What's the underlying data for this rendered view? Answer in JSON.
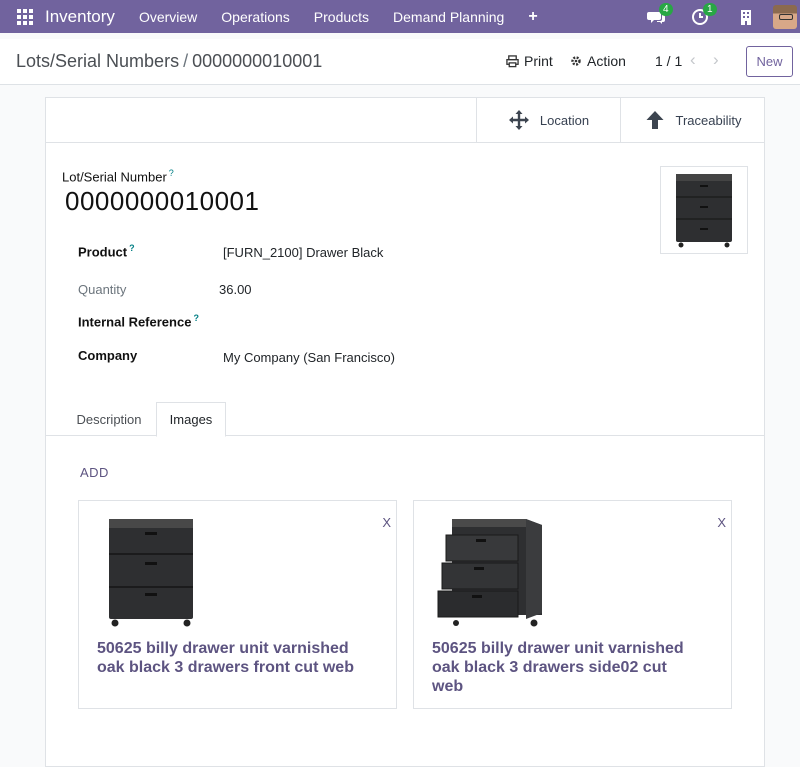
{
  "navbar": {
    "brand": "Inventory",
    "menu": [
      "Overview",
      "Operations",
      "Products",
      "Demand Planning"
    ],
    "plus_label": "+",
    "messages_badge": "4",
    "activities_badge": "1",
    "bg_color": "#71639e"
  },
  "control": {
    "breadcrumb_parent": "Lots/Serial Numbers",
    "breadcrumb_sep": "/",
    "breadcrumb_current": "0000000010001",
    "print_label": "Print",
    "action_label": "Action",
    "pager": "1 / 1",
    "new_label": "New"
  },
  "smart_buttons": {
    "location": "Location",
    "traceability": "Traceability"
  },
  "form": {
    "lot_label": "Lot/Serial Number",
    "help_mark": "?",
    "lot_value": "0000000010001",
    "product_label": "Product",
    "product_value": "[FURN_2100] Drawer Black",
    "quantity_label": "Quantity",
    "quantity_value": "36.00",
    "internal_ref_label": "Internal Reference",
    "company_label": "Company",
    "company_value": "My Company (San Francisco)"
  },
  "tabs": {
    "description": "Description",
    "images": "Images"
  },
  "images": {
    "add_label": "ADD",
    "remove_label": "X",
    "cards": [
      {
        "title": "50625 billy drawer unit varnished oak black 3 drawers front cut web"
      },
      {
        "title": "50625 billy drawer unit varnished oak black 3 drawers side02 cut web"
      }
    ]
  }
}
